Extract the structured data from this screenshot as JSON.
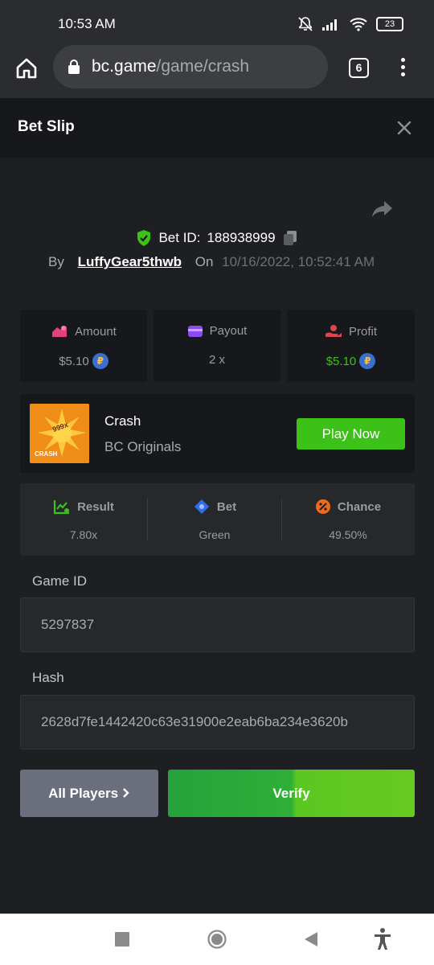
{
  "status_bar": {
    "time": "10:53 AM",
    "battery": "23"
  },
  "browser": {
    "url_host": "bc.game",
    "url_path": "/game/crash",
    "tab_count": "6"
  },
  "header": {
    "title": "Bet Slip"
  },
  "bet": {
    "bet_id_label": "Bet ID:",
    "bet_id": "188938999",
    "by_label": "By",
    "username": "LuffyGear5thwb",
    "on_label": "On",
    "datetime": "10/16/2022, 10:52:41 AM"
  },
  "stats": {
    "amount_label": "Amount",
    "amount_value": "$5.10",
    "payout_label": "Payout",
    "payout_value": "2 x",
    "profit_label": "Profit",
    "profit_value": "$5.10"
  },
  "game": {
    "name": "Crash",
    "provider": "BC Originals",
    "play_label": "Play Now",
    "thumb_badge": "999x",
    "thumb_text": "CRASH"
  },
  "result": {
    "result_label": "Result",
    "result_value": "7.80x",
    "bet_label": "Bet",
    "bet_value": "Green",
    "chance_label": "Chance",
    "chance_value": "49.50%"
  },
  "fields": {
    "game_id_label": "Game ID",
    "game_id": "5297837",
    "hash_label": "Hash",
    "hash": "2628d7fe1442420c63e31900e2eab6ba234e3620b"
  },
  "actions": {
    "all_players": "All Players",
    "verify": "Verify"
  },
  "colors": {
    "accent_green": "#3bc117",
    "profit_green": "#3bc117",
    "amount_icon": "#e0427a",
    "payout_icon": "#8a4cf0",
    "profit_icon": "#e0444a",
    "verified_shield": "#3bc117"
  }
}
